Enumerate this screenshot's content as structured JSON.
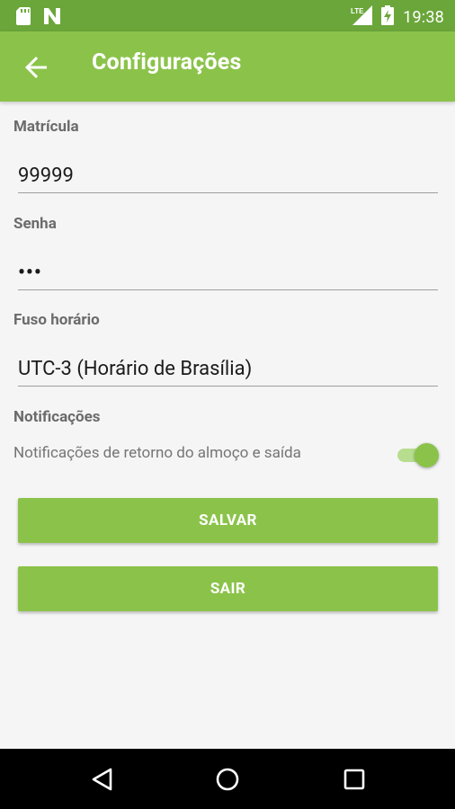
{
  "status_bar": {
    "time": "19:38",
    "network": "LTE",
    "icons": [
      "sd-card-icon",
      "n-notification-icon",
      "lte-signal-icon",
      "battery-charging-icon"
    ]
  },
  "app_bar": {
    "title": "Configurações",
    "back_icon": "arrow-back-icon"
  },
  "form": {
    "matricula": {
      "label": "Matrícula",
      "value": "99999"
    },
    "senha": {
      "label": "Senha",
      "value": "•••"
    },
    "fuso": {
      "label": "Fuso horário",
      "value": "UTC-3 (Horário de Brasília)"
    },
    "notificacoes": {
      "label": "Notificações",
      "toggle_label": "Notificações de retorno do almoço e saída",
      "enabled": true
    }
  },
  "buttons": {
    "save_label": "SALVAR",
    "exit_label": "SAIR"
  },
  "nav_bar": {
    "icons": [
      "back-triangle-icon",
      "home-circle-icon",
      "recents-square-icon"
    ]
  },
  "colors": {
    "primary": "#8bc34a",
    "primary_dark": "#6aa63a",
    "background": "#f5f5f5"
  }
}
